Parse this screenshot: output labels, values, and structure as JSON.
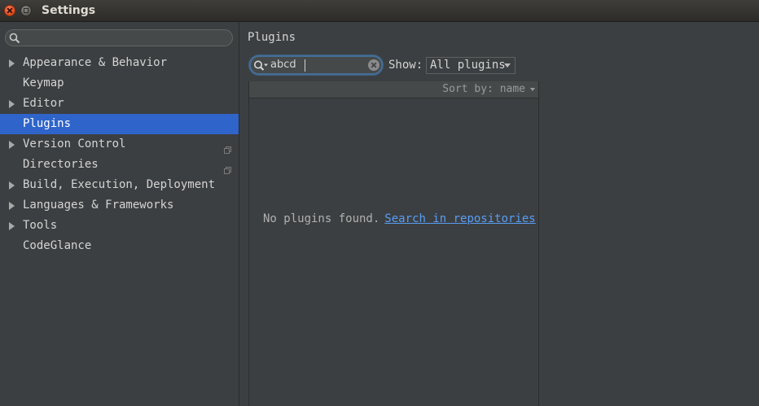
{
  "window": {
    "title": "Settings"
  },
  "sidebar": {
    "search": {
      "value": "",
      "placeholder": ""
    },
    "items": [
      {
        "label": "Appearance & Behavior",
        "expandable": true,
        "selected": false,
        "project_icon": false
      },
      {
        "label": "Keymap",
        "expandable": false,
        "selected": false,
        "project_icon": false
      },
      {
        "label": "Editor",
        "expandable": true,
        "selected": false,
        "project_icon": false
      },
      {
        "label": "Plugins",
        "expandable": false,
        "selected": true,
        "project_icon": false
      },
      {
        "label": "Version Control",
        "expandable": true,
        "selected": false,
        "project_icon": true
      },
      {
        "label": "Directories",
        "expandable": false,
        "selected": false,
        "project_icon": true
      },
      {
        "label": "Build, Execution, Deployment",
        "expandable": true,
        "selected": false,
        "project_icon": false
      },
      {
        "label": "Languages & Frameworks",
        "expandable": true,
        "selected": false,
        "project_icon": false
      },
      {
        "label": "Tools",
        "expandable": true,
        "selected": false,
        "project_icon": false
      },
      {
        "label": "CodeGlance",
        "expandable": false,
        "selected": false,
        "project_icon": false
      }
    ]
  },
  "main": {
    "title": "Plugins",
    "search": {
      "value": "abcd"
    },
    "show_label": "Show:",
    "show_select": {
      "selected": "All plugins"
    },
    "list": {
      "sort_label": "Sort by: name",
      "empty_text": "No plugins found.",
      "link_text": "Search in repositories"
    }
  },
  "colors": {
    "background": "#3c3f41",
    "selection": "#2f65ca",
    "link": "#589df6",
    "focus_border": "#466d94"
  },
  "icons": [
    "close-icon",
    "maximize-icon",
    "search-icon",
    "expand-arrow-icon",
    "project-level-icon",
    "clear-icon",
    "chevron-down-icon"
  ]
}
